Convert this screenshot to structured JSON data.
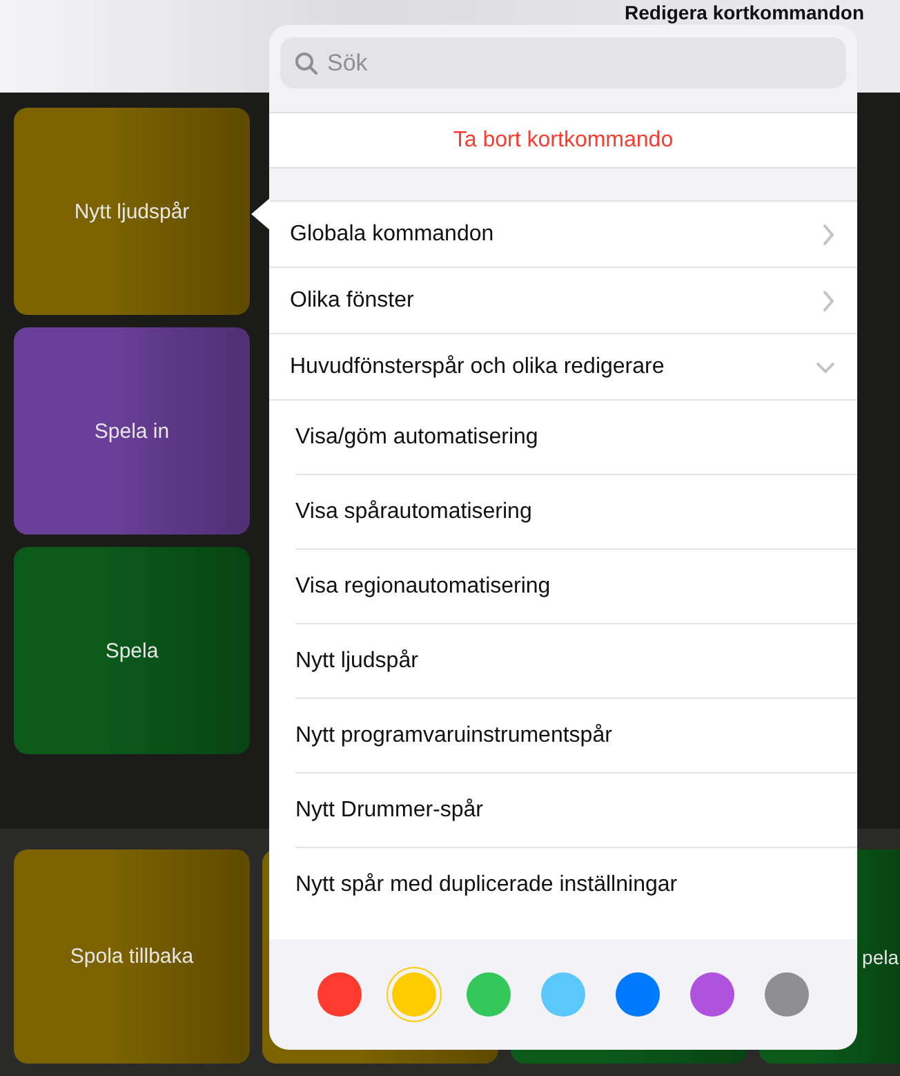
{
  "header": {
    "title": "Redigera kortkommandon"
  },
  "tiles": [
    {
      "label": "Nytt ljudspår",
      "color": "#7d6300"
    },
    {
      "label": "Spela in",
      "color": "#6a3f99"
    },
    {
      "label": "Spela",
      "color": "#0b5a1a"
    }
  ],
  "bottom_tiles": [
    {
      "label": "Spola tillbaka",
      "color": "#7d6300"
    },
    {
      "color": "#7d6300"
    },
    {
      "color": "#0b5a1a"
    },
    {
      "label": "pela",
      "color": "#0b5a1a"
    }
  ],
  "popover": {
    "search": {
      "placeholder": "Sök"
    },
    "delete_action": "Ta bort kortkommando",
    "categories": [
      {
        "label": "Globala kommandon",
        "expanded": false
      },
      {
        "label": "Olika fönster",
        "expanded": false
      },
      {
        "label": "Huvudfönsterspår och olika redigerare",
        "expanded": true,
        "children": [
          "Visa/göm automatisering",
          "Visa spårautomatisering",
          "Visa regionautomatisering",
          "Nytt ljudspår",
          "Nytt programvaruinstrumentspår",
          "Nytt Drummer-spår",
          "Nytt spår med duplicerade inställningar"
        ]
      }
    ],
    "colors": [
      {
        "color": "#ff3b30",
        "selected": false
      },
      {
        "color": "#ffcc00",
        "selected": true
      },
      {
        "color": "#34c759",
        "selected": false
      },
      {
        "color": "#5ac8fa",
        "selected": false
      },
      {
        "color": "#007aff",
        "selected": false
      },
      {
        "color": "#af52de",
        "selected": false
      },
      {
        "color": "#8e8e93",
        "selected": false
      }
    ]
  }
}
